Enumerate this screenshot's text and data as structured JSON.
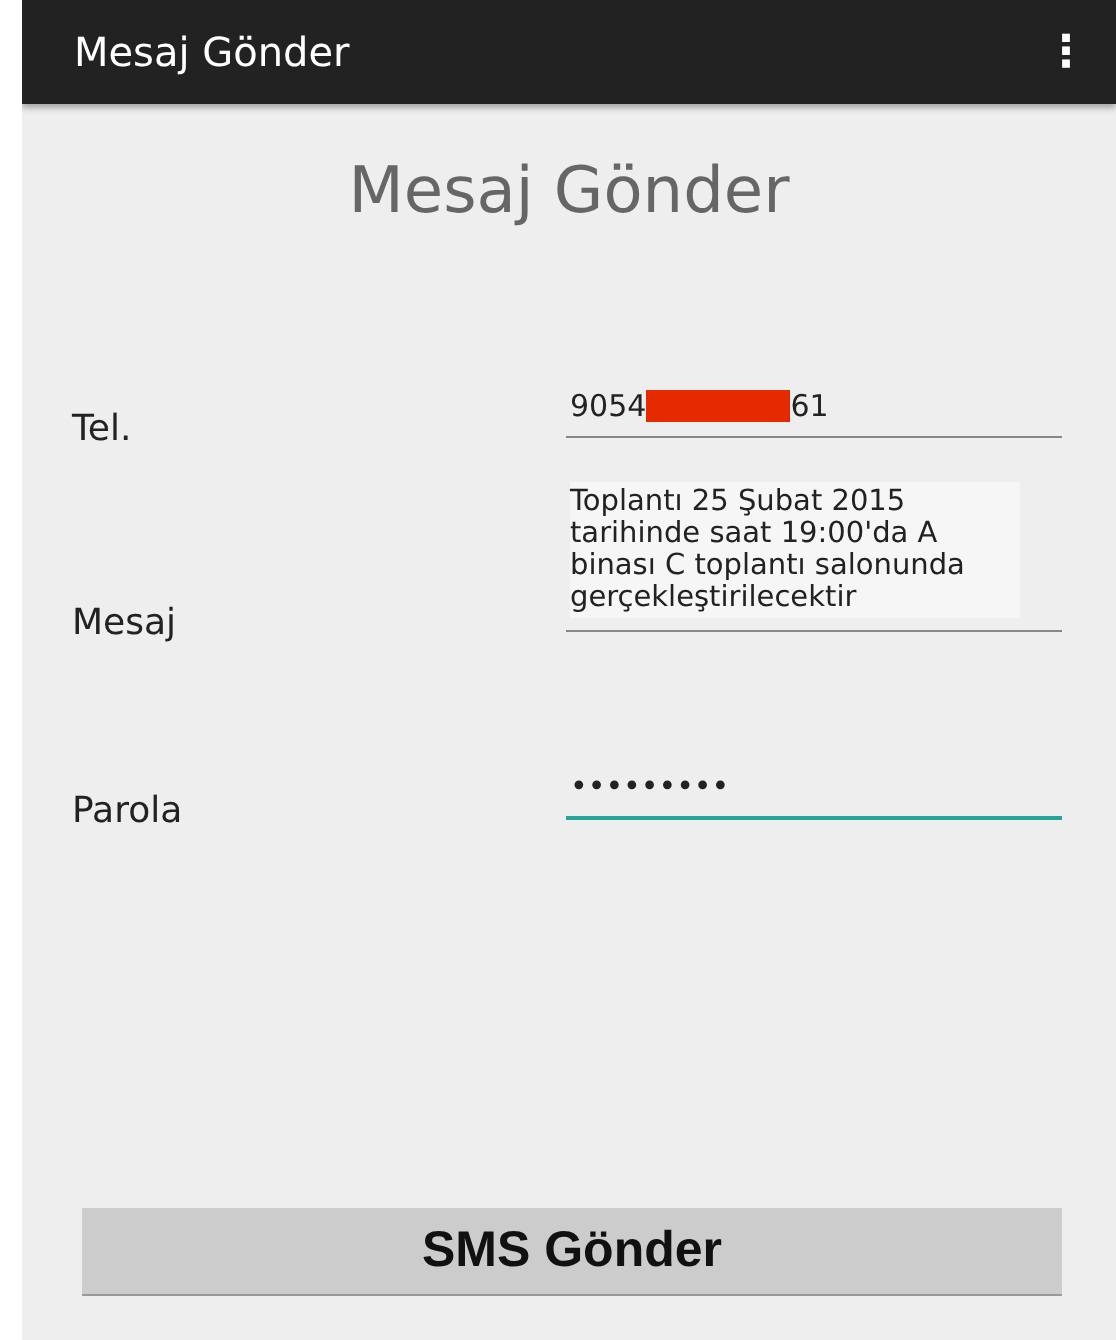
{
  "app_bar": {
    "title": "Mesaj Gönder",
    "menu": "⋮"
  },
  "heading": "Mesaj Gönder",
  "fields": [
    {
      "kind": "phone",
      "label": "Tel.",
      "value_start": "9054",
      "redacted": true,
      "value_end": "61",
      "focused": false
    },
    {
      "kind": "multiline",
      "label": "Mesaj",
      "value": "Toplantı 25 Şubat 2015 tarihinde saat 19:00'da A binası C toplantı salonunda gerçekleştirilecektir",
      "focused": false
    },
    {
      "kind": "password",
      "label": "Parola",
      "value": "•••••••••",
      "focused": true
    }
  ],
  "button": "SMS Gönder"
}
